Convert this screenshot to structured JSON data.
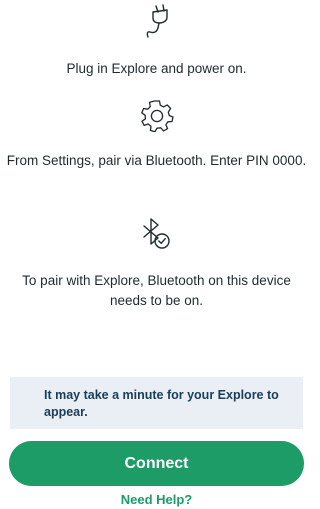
{
  "steps": [
    {
      "icon": "plug-icon",
      "text": "Plug in Explore and power on."
    },
    {
      "icon": "gear-icon",
      "text": "From Settings, pair via Bluetooth. Enter PIN 0000."
    },
    {
      "icon": "bluetooth-check-icon",
      "text": "To pair with Explore, Bluetooth on this device needs to be on."
    }
  ],
  "notice": {
    "text": "It may take a minute for your Explore to appear."
  },
  "actions": {
    "connect_label": "Connect",
    "help_label": "Need Help?"
  },
  "colors": {
    "accent": "#1d9c68",
    "notice_bg": "#e9eff4",
    "notice_text": "#1b3e57"
  }
}
